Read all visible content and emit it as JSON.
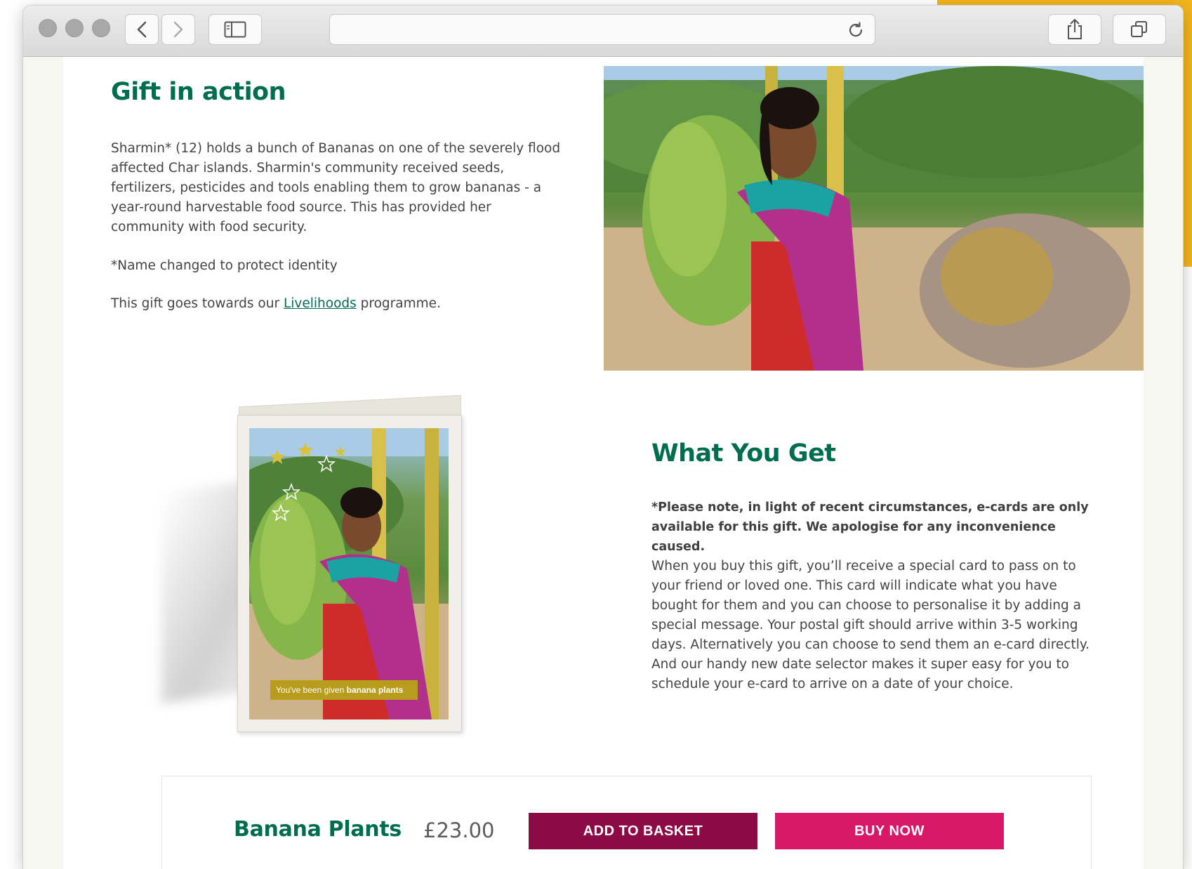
{
  "browser": {
    "url": ""
  },
  "gift_in_action": {
    "title": "Gift in action",
    "paragraph": "Sharmin* (12) holds a bunch of Bananas on one of the severely flood affected Char islands. Sharmin's community received seeds, fertilizers, pesticides and tools enabling them to grow bananas - a year-round harvestable food source. This has provided her community with food security.",
    "note": "*Name changed to protect identity",
    "programme_prefix": "This gift goes towards our ",
    "programme_link": "Livelihoods",
    "programme_suffix": " programme."
  },
  "card": {
    "caption_prefix": "You've been given ",
    "caption_bold": "banana plants"
  },
  "what_you_get": {
    "title": "What You Get",
    "note": "*Please note, in light of recent circumstances, e-cards are only available for this gift. We apologise for any inconvenience caused.",
    "body": "When you buy this gift, you’ll receive a special card to pass on to your friend or loved one. This card will indicate what you have bought for them and you can choose to personalise it by adding a special message. Your postal gift should arrive within 3-5 working days. Alternatively you can choose to send them an e-card directly. And our handy new date selector makes it super easy for you to schedule your e-card to arrive on a date of your choice."
  },
  "purchase": {
    "product_name": "Banana Plants",
    "price": "£23.00",
    "add_to_basket_label": "ADD TO BASKET",
    "buy_now_label": "BUY NOW"
  },
  "colors": {
    "brand_green": "#006d4e",
    "basket_button": "#8c0a46",
    "buy_button": "#d81866",
    "accent_yellow": "#f2b51c"
  }
}
